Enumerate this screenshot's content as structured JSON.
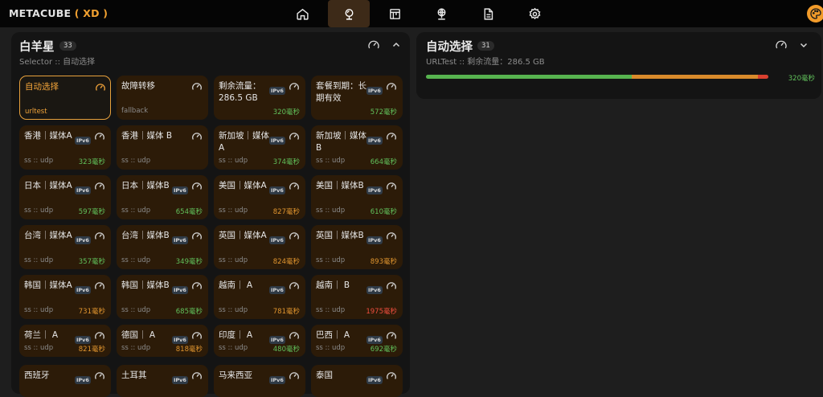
{
  "app": {
    "logo_main": "METACUBE",
    "logo_open": "(",
    "logo_xd": " XD ",
    "logo_close": ")"
  },
  "nav": [
    {
      "name": "home-icon",
      "active": false
    },
    {
      "name": "proxies-icon",
      "active": true
    },
    {
      "name": "rules-icon",
      "active": false
    },
    {
      "name": "connections-icon",
      "active": false
    },
    {
      "name": "logs-icon",
      "active": false
    },
    {
      "name": "settings-icon",
      "active": false
    }
  ],
  "left_group": {
    "title": "白羊星",
    "count": "33",
    "subtitle": "Selector :: 自动选择",
    "proxies": [
      {
        "name": "自动选择",
        "type": "urltest",
        "ipv6": false,
        "delay": "",
        "level": "",
        "selected": true
      },
      {
        "name": "故障转移",
        "type": "fallback",
        "ipv6": false,
        "delay": "",
        "level": "",
        "selected": false
      },
      {
        "name": "剩余流量：286.5 GB",
        "type": "",
        "ipv6": true,
        "delay": "320毫秒",
        "level": "g",
        "selected": false
      },
      {
        "name": "套餐到期：长期有效",
        "type": "",
        "ipv6": true,
        "delay": "572毫秒",
        "level": "g",
        "selected": false
      },
      {
        "name": "香港｜媒体A",
        "type": "ss :: udp",
        "ipv6": true,
        "delay": "323毫秒",
        "level": "g",
        "selected": false
      },
      {
        "name": "香港｜媒体 B",
        "type": "ss :: udp",
        "ipv6": false,
        "delay": "",
        "level": "",
        "selected": false
      },
      {
        "name": "新加坡｜媒体 A",
        "type": "ss :: udp",
        "ipv6": true,
        "delay": "374毫秒",
        "level": "g",
        "selected": false
      },
      {
        "name": "新加坡｜媒体 B",
        "type": "ss :: udp",
        "ipv6": true,
        "delay": "664毫秒",
        "level": "g",
        "selected": false
      },
      {
        "name": "日本｜媒体A",
        "type": "ss :: udp",
        "ipv6": true,
        "delay": "597毫秒",
        "level": "g",
        "selected": false
      },
      {
        "name": "日本｜媒体B",
        "type": "ss :: udp",
        "ipv6": true,
        "delay": "654毫秒",
        "level": "g",
        "selected": false
      },
      {
        "name": "美国｜媒体A",
        "type": "ss :: udp",
        "ipv6": true,
        "delay": "827毫秒",
        "level": "o",
        "selected": false
      },
      {
        "name": "美国｜媒体B",
        "type": "ss :: udp",
        "ipv6": true,
        "delay": "610毫秒",
        "level": "g",
        "selected": false
      },
      {
        "name": "台湾｜媒体A",
        "type": "ss :: udp",
        "ipv6": true,
        "delay": "357毫秒",
        "level": "g",
        "selected": false
      },
      {
        "name": "台湾｜媒体B",
        "type": "ss :: udp",
        "ipv6": true,
        "delay": "349毫秒",
        "level": "g",
        "selected": false
      },
      {
        "name": "英国｜媒体A",
        "type": "ss :: udp",
        "ipv6": true,
        "delay": "824毫秒",
        "level": "o",
        "selected": false
      },
      {
        "name": "英国｜媒体B",
        "type": "ss :: udp",
        "ipv6": true,
        "delay": "893毫秒",
        "level": "o",
        "selected": false
      },
      {
        "name": "韩国｜媒体A",
        "type": "ss :: udp",
        "ipv6": true,
        "delay": "731毫秒",
        "level": "o",
        "selected": false
      },
      {
        "name": "韩国｜媒体B",
        "type": "ss :: udp",
        "ipv6": true,
        "delay": "685毫秒",
        "level": "g",
        "selected": false
      },
      {
        "name": "越南｜ A",
        "type": "ss :: udp",
        "ipv6": true,
        "delay": "781毫秒",
        "level": "o",
        "selected": false
      },
      {
        "name": "越南｜ B",
        "type": "ss :: udp",
        "ipv6": true,
        "delay": "1975毫秒",
        "level": "r",
        "selected": false
      },
      {
        "name": "荷兰｜ A",
        "type": "ss :: udp",
        "ipv6": true,
        "delay": "821毫秒",
        "level": "o",
        "selected": false
      },
      {
        "name": "德国｜ A",
        "type": "ss :: udp",
        "ipv6": true,
        "delay": "818毫秒",
        "level": "o",
        "selected": false
      },
      {
        "name": "印度｜ A",
        "type": "ss :: udp",
        "ipv6": true,
        "delay": "480毫秒",
        "level": "g",
        "selected": false
      },
      {
        "name": "巴西｜ A",
        "type": "ss :: udp",
        "ipv6": true,
        "delay": "692毫秒",
        "level": "g",
        "selected": false
      },
      {
        "name": "西班牙",
        "type": "",
        "ipv6": true,
        "delay": "",
        "level": "",
        "selected": false
      },
      {
        "name": "土耳其",
        "type": "",
        "ipv6": true,
        "delay": "",
        "level": "",
        "selected": false
      },
      {
        "name": "马来西亚",
        "type": "",
        "ipv6": true,
        "delay": "",
        "level": "",
        "selected": false
      },
      {
        "name": "泰国",
        "type": "",
        "ipv6": true,
        "delay": "",
        "level": "",
        "selected": false
      }
    ]
  },
  "right_group": {
    "title": "自动选择",
    "count": "31",
    "subtitle": "URLTest :: 剩余流量：286.5 GB",
    "delay": "320毫秒",
    "latency_distribution": [
      {
        "color": "#57b44f",
        "fraction": 0.6
      },
      {
        "color": "#d98b2b",
        "fraction": 0.37
      },
      {
        "color": "#d9402f",
        "fraction": 0.03
      }
    ]
  },
  "ipv6_label": "IPv6",
  "colors": {
    "accent": "#f2a43a",
    "good": "#61c15b",
    "medium": "#e0952f",
    "bad": "#ef4e3e"
  }
}
